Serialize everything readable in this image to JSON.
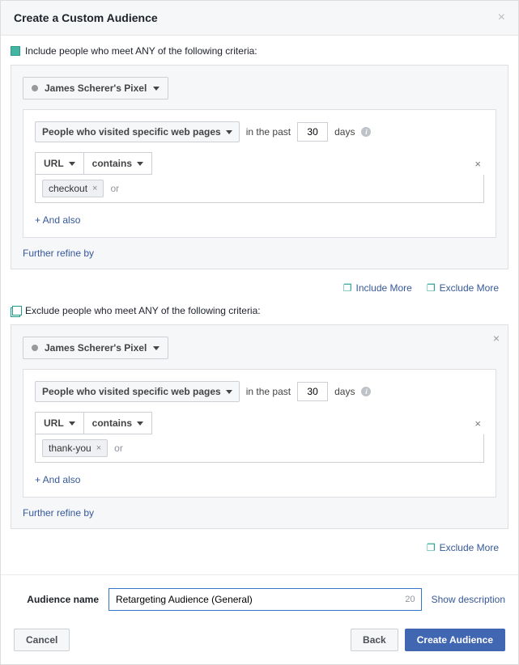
{
  "header": {
    "title": "Create a Custom Audience"
  },
  "include": {
    "label": "Include people who meet ANY of the following criteria:",
    "pixel": "James Scherer's Pixel",
    "condition": "People who visited specific web pages",
    "past_label_a": "in the past",
    "days_value": "30",
    "past_label_b": "days",
    "url_field": "URL",
    "operator": "contains",
    "tag": "checkout",
    "or": "or",
    "and_also": "+ And also",
    "refine": "Further refine by"
  },
  "middle_actions": {
    "include_more": "Include More",
    "exclude_more": "Exclude More"
  },
  "exclude": {
    "label": "Exclude people who meet ANY of the following criteria:",
    "pixel": "James Scherer's Pixel",
    "condition": "People who visited specific web pages",
    "past_label_a": "in the past",
    "days_value": "30",
    "past_label_b": "days",
    "url_field": "URL",
    "operator": "contains",
    "tag": "thank-you",
    "or": "or",
    "and_also": "+ And also",
    "refine": "Further refine by"
  },
  "bottom_actions": {
    "exclude_more": "Exclude More"
  },
  "footer": {
    "name_label": "Audience name",
    "name_value": "Retargeting Audience (General)",
    "char_count": "20",
    "show_desc": "Show description",
    "cancel": "Cancel",
    "back": "Back",
    "create": "Create Audience"
  }
}
